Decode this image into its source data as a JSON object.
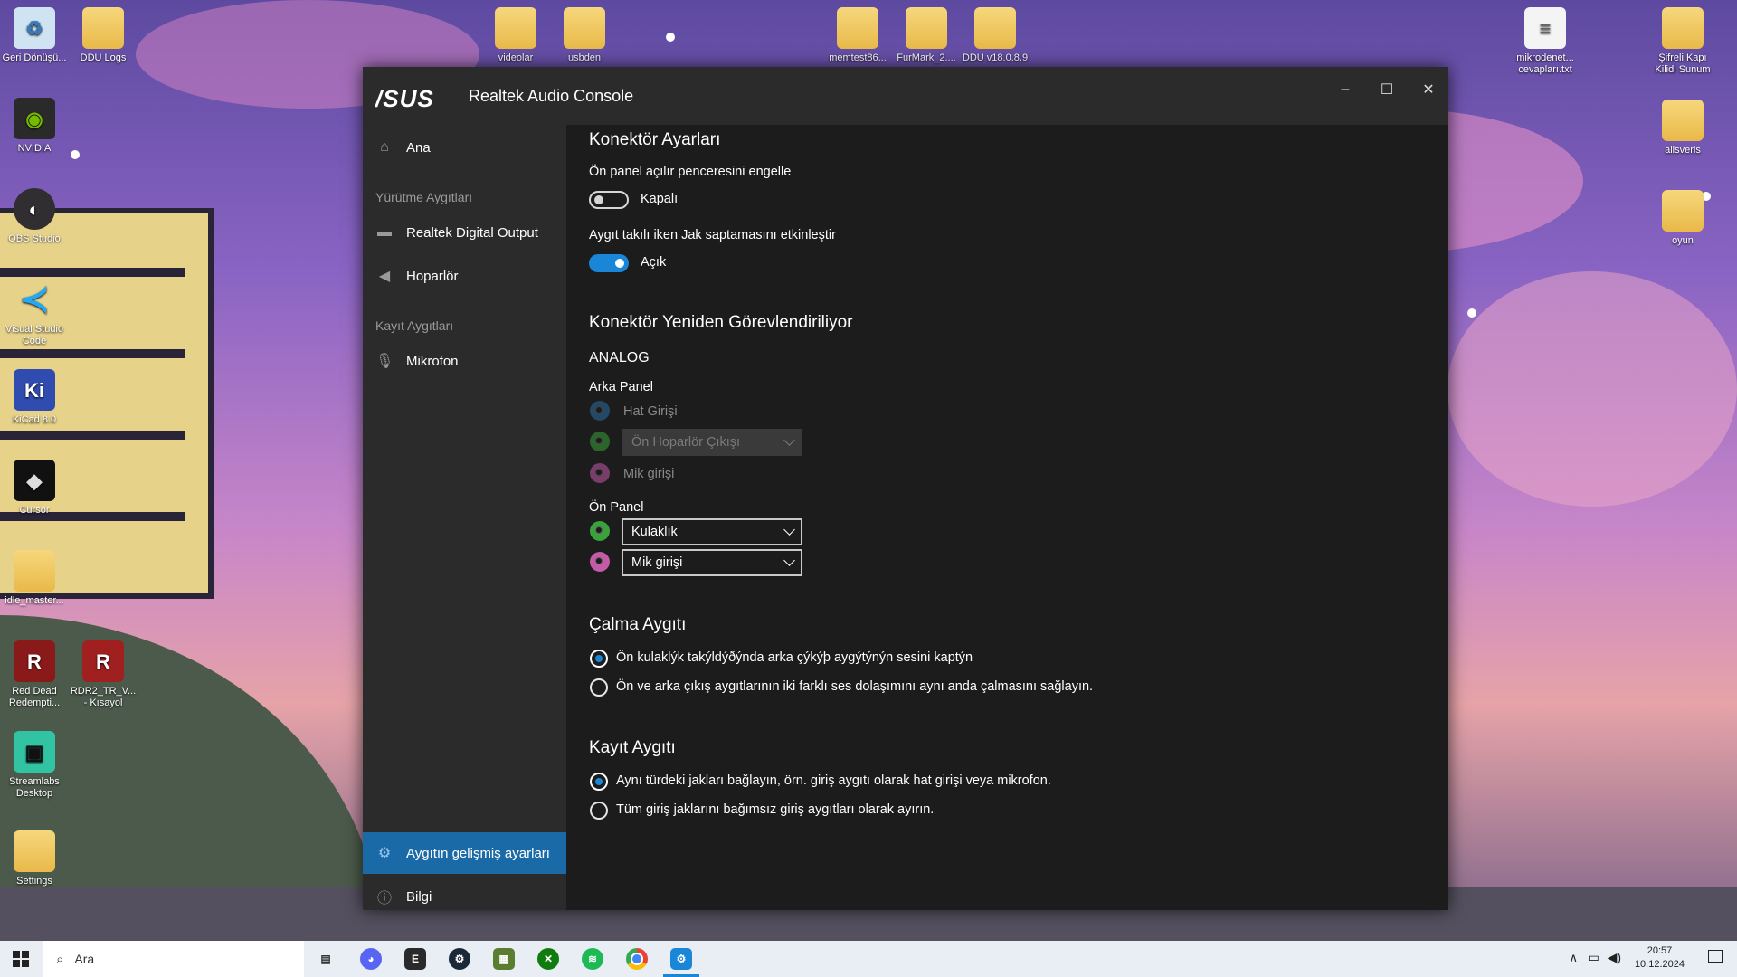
{
  "desktop": {
    "icons": [
      {
        "label": "Geri Dönüşü...",
        "icon": "recycle-bin-icon"
      },
      {
        "label": "DDU Logs",
        "icon": "folder-icon"
      },
      {
        "label": "NVIDIA",
        "icon": "nvidia-icon"
      },
      {
        "label": "OBS Studio",
        "icon": "obs-icon"
      },
      {
        "label": "Visual Studio Code",
        "icon": "vscode-icon"
      },
      {
        "label": "KiCad 8.0",
        "icon": "kicad-icon"
      },
      {
        "label": "Cursor",
        "icon": "cursor-icon"
      },
      {
        "label": "idle_master...",
        "icon": "folder-icon"
      },
      {
        "label": "Red Dead Redempti...",
        "icon": "rdr-icon"
      },
      {
        "label": "RDR2_TR_V... - Kısayol",
        "icon": "rdr-icon"
      },
      {
        "label": "Streamlabs Desktop",
        "icon": "streamlabs-icon"
      },
      {
        "label": "Settings",
        "icon": "folder-icon"
      },
      {
        "label": "videolar",
        "icon": "folder-icon"
      },
      {
        "label": "usbden",
        "icon": "folder-icon"
      },
      {
        "label": "memtest86...",
        "icon": "folder-icon"
      },
      {
        "label": "FurMark_2....",
        "icon": "folder-icon"
      },
      {
        "label": "DDU v18.0.8.9",
        "icon": "folder-icon"
      },
      {
        "label": "mikrodenet... cevapları.txt",
        "icon": "text-file-icon"
      },
      {
        "label": "Şifreli Kapı Kilidi Sunum",
        "icon": "folder-icon"
      },
      {
        "label": "alisveris",
        "icon": "folder-icon"
      },
      {
        "label": "oyun",
        "icon": "folder-icon"
      }
    ]
  },
  "window": {
    "logo": "/SUS",
    "title": "Realtek Audio Console",
    "controls": {
      "minimize": "–",
      "maximize": "☐",
      "close": "✕"
    }
  },
  "sidebar": {
    "home": "Ana",
    "playback_section": "Yürütme Aygıtları",
    "playback_items": [
      "Realtek Digital Output",
      "Hoparlör"
    ],
    "record_section": "Kayıt Aygıtları",
    "record_items": [
      "Mikrofon"
    ],
    "advanced": "Aygıtın gelişmiş ayarları",
    "info": "Bilgi"
  },
  "content": {
    "connector_settings_title": "Konektör Ayarları",
    "front_popup_label": "Ön panel açılır penceresini engelle",
    "front_popup_state": "Kapalı",
    "front_popup_on": false,
    "jack_detect_label": "Aygıt takılı iken Jak saptamasını etkinleştir",
    "jack_detect_state": "Açık",
    "jack_detect_on": true,
    "reassign_title": "Konektör Yeniden Görevlendiriliyor",
    "analog": "ANALOG",
    "rear_panel": "Arka Panel",
    "rear_line_in": "Hat Girişi",
    "rear_speaker_select": "Ön Hoparlör Çıkışı",
    "rear_mic_in": "Mik girişi",
    "front_panel": "Ön Panel",
    "front_select_1": "Kulaklık",
    "front_select_2": "Mik girişi",
    "playback_device_title": "Çalma Aygıtı",
    "playback_option_1": "Ön kulaklýk takýldýðýnda arka çýkýþ aygýtýnýn sesini kaptýn",
    "playback_option_2": "Ön ve arka çıkış aygıtlarının iki farklı ses dolaşımını aynı anda çalmasını sağlayın.",
    "record_device_title": "Kayıt Aygıtı",
    "record_option_1": "Aynı türdeki jakları bağlayın, örn. giriş aygıtı olarak hat girişi veya mikrofon.",
    "record_option_2": "Tüm giriş jaklarını bağımsız giriş aygıtları olarak ayırın."
  },
  "colors": {
    "accent": "#1a86d8",
    "jack_blue": "#2b6fa0",
    "jack_green": "#3aa23a",
    "jack_pink": "#c45aa8"
  },
  "taskbar": {
    "search_placeholder": "Ara",
    "time": "20:57",
    "date": "10.12.2024",
    "pinned": [
      "task-view-icon",
      "discord-icon",
      "epic-games-icon",
      "steam-icon",
      "minecraft-icon",
      "xbox-icon",
      "spotify-icon",
      "chrome-icon",
      "realtek-icon"
    ]
  }
}
